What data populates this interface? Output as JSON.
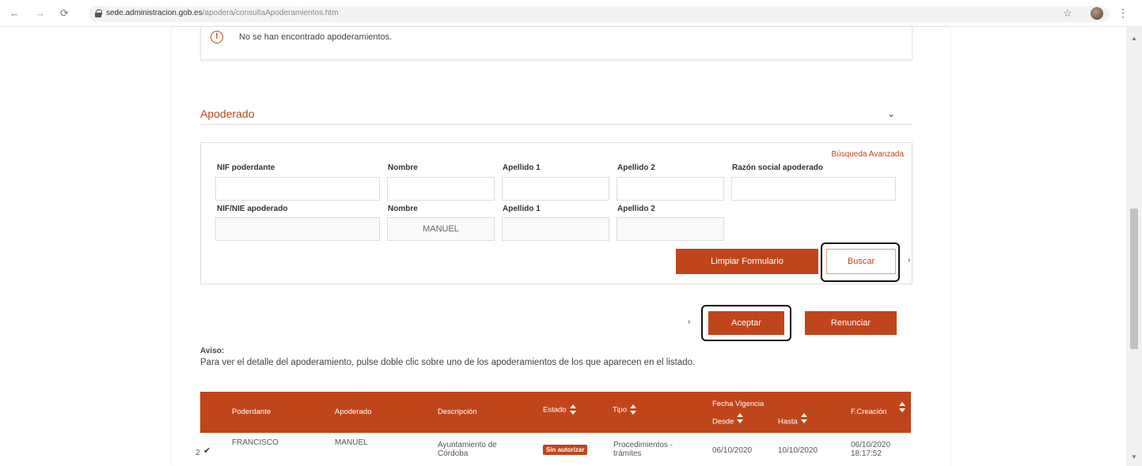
{
  "browser": {
    "back": "←",
    "forward": "→",
    "reload": "⟳",
    "url_host": "sede.administracion.gob.es",
    "url_path": "/apodera/consultaApoderamientos.htm",
    "star": "☆",
    "menu": "⋮"
  },
  "notice": {
    "icon": "!",
    "text": "No se han encontrado apoderamientos."
  },
  "section": {
    "title": "Apoderado",
    "chevron": "⌄"
  },
  "search": {
    "advanced_link": "Búsqueda Avanzada",
    "row1_labels": {
      "nif": "NIF poderdante",
      "nombre": "Nombre",
      "apellido1": "Apellido 1",
      "apellido2": "Apellido 2",
      "razon": "Razón social apoderado"
    },
    "row2_labels": {
      "nif": "NIF/NIE apoderado",
      "nombre": "Nombre",
      "apellido1": "Apellido 1",
      "apellido2": "Apellido 2"
    },
    "row2_values": {
      "nombre": "MANUEL"
    },
    "clear_button": "Limpiar Formulario",
    "search_button": "Buscar"
  },
  "actions": {
    "arrow": "›",
    "accept_button": "Aceptar",
    "renounce_button": "Renunciar"
  },
  "aviso": {
    "title": "Aviso:",
    "text": "Para ver el detalle del apoderamiento, pulse doble clic sobre uno de los apoderamientos de los que aparecen en el listado."
  },
  "table": {
    "headers": {
      "poderdante": "Poderdante",
      "apoderado": "Apoderado",
      "descripcion": "Descripción",
      "estado": "Estado",
      "tipo": "Tipo",
      "fecha_vigencia": "Fecha Vigencia",
      "desde": "Desde",
      "hasta": "Hasta",
      "creacion": "F.Creación"
    },
    "row": {
      "index": "2",
      "check": "✔",
      "poderdante": "FRANCISCO",
      "apoderado": "MANUEL",
      "descripcion": "Ayuntamiento de Córdoba",
      "estado": "Sin autorizar",
      "tipo": "Procedimientos - trámites",
      "desde": "06/10/2020",
      "hasta": "10/10/2020",
      "creacion": "06/10/2020 18:17:52"
    }
  },
  "colors": {
    "accent": "#c0451b",
    "header_bg": "#c0451b"
  }
}
